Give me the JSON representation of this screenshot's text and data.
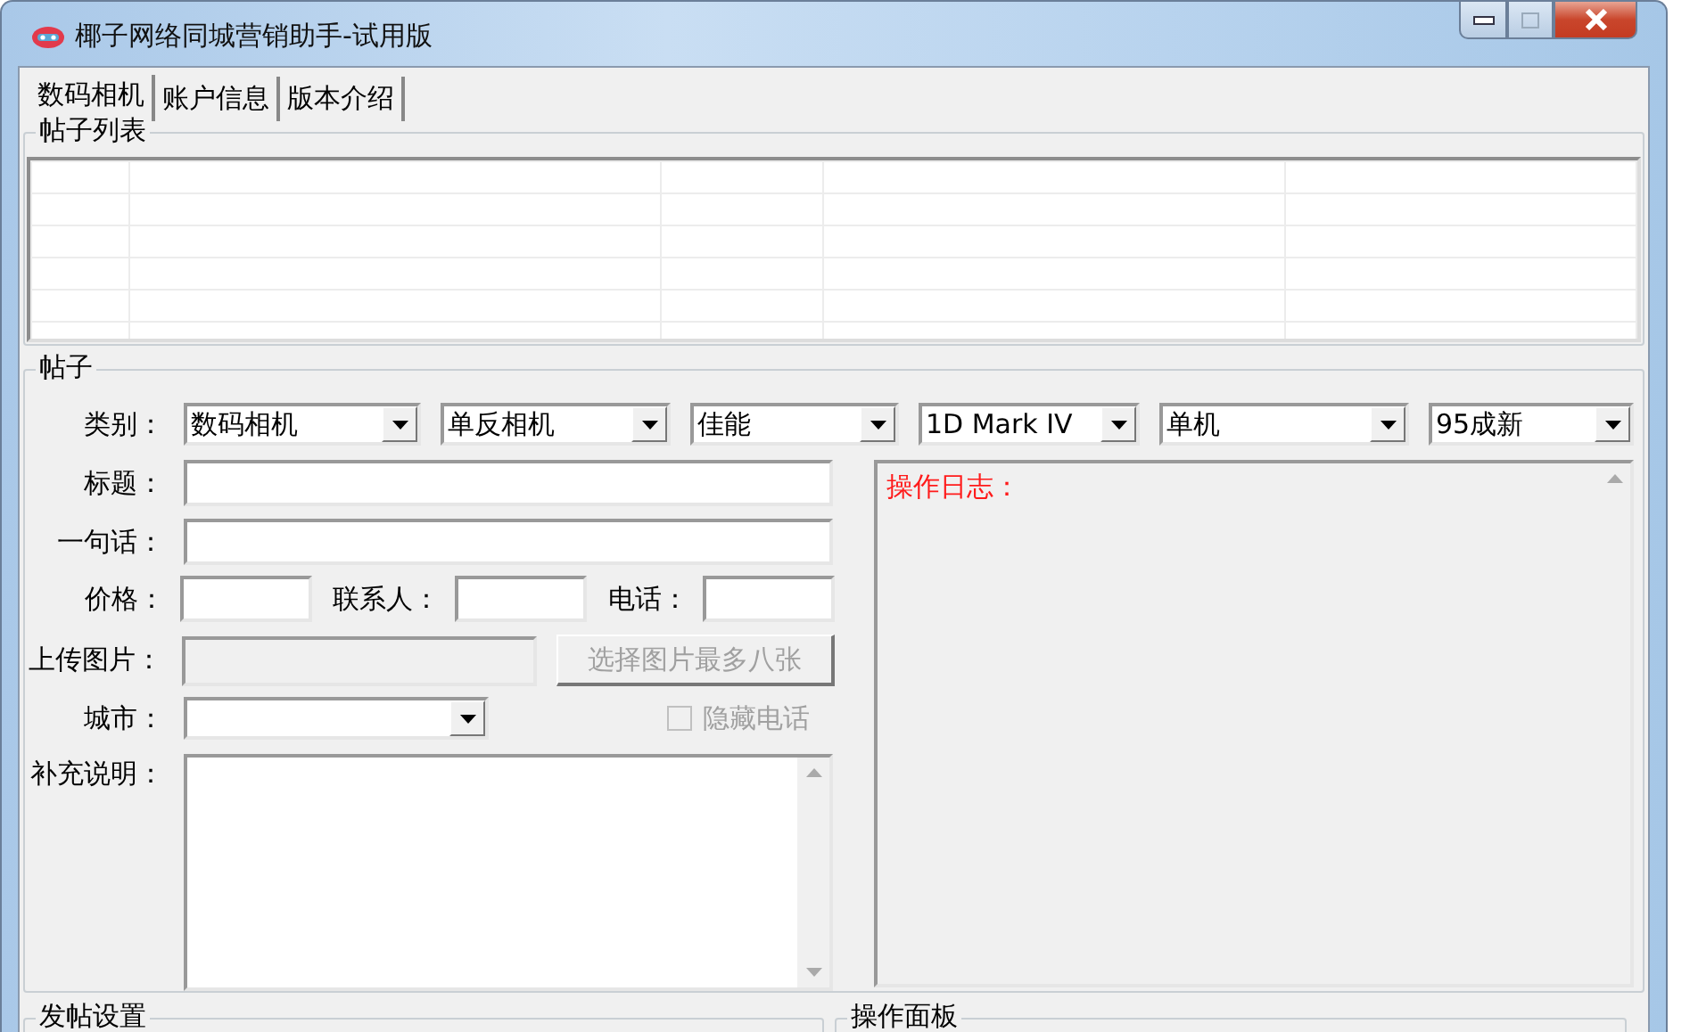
{
  "window": {
    "title": "椰子网络同城营销助手-试用版"
  },
  "tabs": [
    {
      "label": "数码相机",
      "selected": true
    },
    {
      "label": "账户信息",
      "selected": false
    },
    {
      "label": "版本介绍",
      "selected": false
    }
  ],
  "post_list": {
    "title": "帖子列表"
  },
  "post": {
    "title": "帖子",
    "category": {
      "label": "类别：",
      "selects": [
        "数码相机",
        "单反相机",
        "佳能",
        "1D Mark IV",
        "单机",
        "95成新"
      ]
    },
    "title_field": {
      "label": "标题："
    },
    "one_line_field": {
      "label": "一句话："
    },
    "price": {
      "label": "价格："
    },
    "contact": {
      "label": "联系人："
    },
    "phone": {
      "label": "电话："
    },
    "upload": {
      "label": "上传图片：",
      "disabled": true
    },
    "select_images_button": {
      "label": "选择图片最多八张",
      "disabled": true
    },
    "city": {
      "label": "城市："
    },
    "hide_phone": {
      "label": "隐藏电话",
      "checked": false,
      "disabled": true
    },
    "notes": {
      "label": "补充说明："
    },
    "log": {
      "text": "操作日志："
    }
  },
  "bottom_groups": [
    {
      "title": "发帖设置"
    },
    {
      "title": "操作面板"
    }
  ]
}
